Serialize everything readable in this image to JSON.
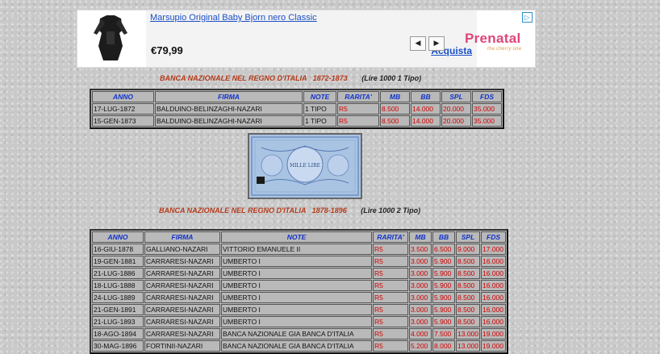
{
  "ad": {
    "title": "Marsupio Original Baby Bjorn nero Classic",
    "price": "€79,99",
    "cta": "Acquista",
    "prev": "◀",
    "next": "▶",
    "adchoices": "▷",
    "brand": "Prenatal",
    "brand_tagline": "the cherry one"
  },
  "section1": {
    "heading": "BANCA NAZIONALE NEL REGNO D'ITALIA",
    "years": "1872-1873",
    "type": "(Lire 1000 1 Tipo)",
    "headers": [
      "ANNO",
      "FIRMA",
      "NOTE",
      "RARITA'",
      "MB",
      "BB",
      "SPL",
      "FDS"
    ],
    "rows": [
      [
        "17-LUG-1872",
        "BALDUINO-BELINZAGHI-NAZARI",
        "1 TIPO",
        "R5",
        "8.500",
        "14.000",
        "20.000",
        "35.000"
      ],
      [
        "15-GEN-1873",
        "BALDUINO-BELINZAGHI-NAZARI",
        "1 TIPO",
        "R5",
        "8.500",
        "14.000",
        "20.000",
        "35.000"
      ]
    ]
  },
  "banknote": {
    "title_text": "MILLE LIRE",
    "color": "#aac4e4"
  },
  "section2": {
    "heading": "BANCA NAZIONALE NEL REGNO D'ITALIA",
    "years": "1878-1896",
    "type": "(Lire 1000 2 Tipo)",
    "headers": [
      "ANNO",
      "FIRMA",
      "NOTE",
      "RARITA'",
      "MB",
      "BB",
      "SPL",
      "FDS"
    ],
    "rows": [
      [
        "16-GIU-1878",
        "GALLIANO-NAZARI",
        "VITTORIO EMANUELE II",
        "R5",
        "3.500",
        "6.500",
        "9.000",
        "17.000"
      ],
      [
        "19-GEN-1881",
        "CARRARESI-NAZARI",
        "UMBERTO I",
        "R5",
        "3.000",
        "5.900",
        "8.500",
        "16.000"
      ],
      [
        "21-LUG-1886",
        "CARRARESI-NAZARI",
        "UMBERTO I",
        "R5",
        "3.000",
        "5.900",
        "8.500",
        "16.000"
      ],
      [
        "18-LUG-1888",
        "CARRARESI-NAZARI",
        "UMBERTO I",
        "R5",
        "3.000",
        "5.900",
        "8.500",
        "16.000"
      ],
      [
        "24-LUG-1889",
        "CARRARESI-NAZARI",
        "UMBERTO I",
        "R5",
        "3.000",
        "5.900",
        "8.500",
        "16.000"
      ],
      [
        "21-GEN-1891",
        "CARRARESI-NAZARI",
        "UMBERTO I",
        "R5",
        "3.000",
        "5.900",
        "8.500",
        "16.000"
      ],
      [
        "21-LUG-1893",
        "CARRARESI-NAZARI",
        "UMBERTO I",
        "R5",
        "3.000",
        "5.900",
        "8.500",
        "16.000"
      ],
      [
        "18-AGO-1894",
        "CARRARESI-NAZARI",
        "BANCA NAZIONALE GIA BANCA D'ITALIA",
        "R5",
        "4.000",
        "7.500",
        "13.000",
        "19.000"
      ],
      [
        "30-MAG-1896",
        "FORTINII-NAZARI",
        "BANCA NAZIONALE GIA BANCA D'ITALIA",
        "R5",
        "5.200",
        "8.000",
        "13.000",
        "19.000"
      ]
    ]
  }
}
